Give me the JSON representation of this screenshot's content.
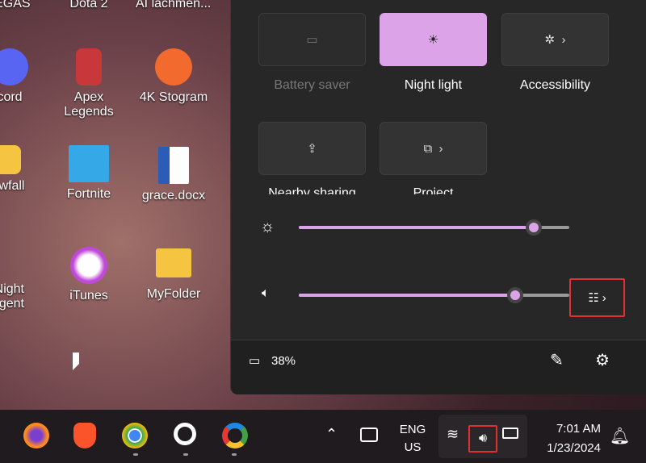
{
  "desktop": {
    "icons": [
      {
        "label": "VEGAS"
      },
      {
        "label": "Dota 2"
      },
      {
        "label": "AI lachmen..."
      },
      {
        "label": "cord"
      },
      {
        "label": "Apex Legends"
      },
      {
        "label": "4K Stogram"
      },
      {
        "label": "owfall"
      },
      {
        "label": "Fortnite"
      },
      {
        "label": "grace.docx"
      },
      {
        "label": "Night gent"
      },
      {
        "label": "iTunes"
      },
      {
        "label": "MyFolder"
      }
    ]
  },
  "quick_settings": {
    "tiles": [
      {
        "label": "Battery saver",
        "icon": "battery-saver-icon",
        "state": "disabled"
      },
      {
        "label": "Night light",
        "icon": "night-light-icon",
        "state": "on"
      },
      {
        "label": "Accessibility",
        "icon": "accessibility-icon",
        "state": "off"
      },
      {
        "label": "Nearby sharing",
        "icon": "share-icon",
        "state": "off"
      },
      {
        "label": "Project",
        "icon": "project-icon",
        "state": "off"
      }
    ],
    "brightness_percent": 87,
    "volume_percent": 80,
    "battery": "38%"
  },
  "taskbar": {
    "language": "ENG",
    "region": "US",
    "time": "7:01 AM",
    "date": "1/23/2024"
  },
  "colors": {
    "accent": "#dca3e8",
    "highlight": "#e03030"
  }
}
